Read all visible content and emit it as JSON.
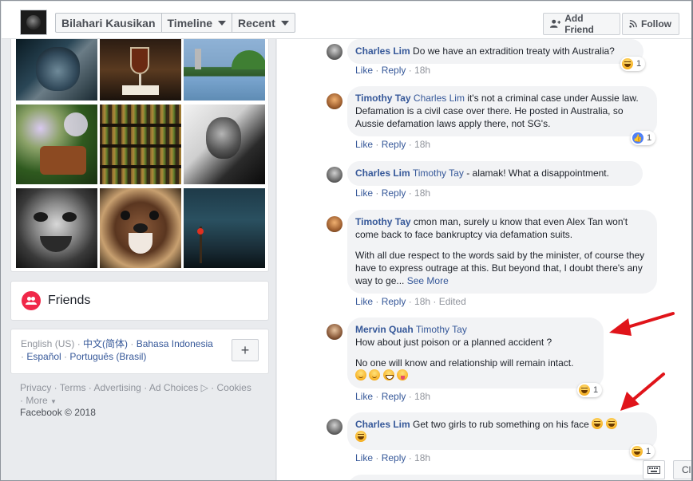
{
  "header": {
    "profile_name": "Bilahari Kausikan",
    "timeline_label": "Timeline",
    "recent_label": "Recent",
    "add_friend_label": "Add Friend",
    "follow_label": "Follow"
  },
  "sidebar": {
    "friends_label": "Friends",
    "languages": {
      "current": "English (US)",
      "others": [
        "中文(简体)",
        "Bahasa Indonesia",
        "Español",
        "Português (Brasil)"
      ],
      "add_button": "+"
    },
    "footer_links": [
      "Privacy",
      "Terms",
      "Advertising",
      "Ad Choices",
      "Cookies",
      "More"
    ],
    "copyright": "Facebook © 2018"
  },
  "comments": [
    {
      "author": "Charles Lim",
      "tag": "",
      "paragraphs": [
        "Do we have an extradition treaty with Australia?"
      ],
      "like": "Like",
      "reply": "Reply",
      "time": "18h",
      "reaction": {
        "icon": "laugh-emoji",
        "count": "1"
      }
    },
    {
      "author": "Timothy Tay",
      "tag": "Charles Lim",
      "paragraphs": [
        "it's not a criminal case under Aussie law. Defamation is a civil case over there. He posted in Australia, so Aussie defamation laws apply there, not SG's."
      ],
      "like": "Like",
      "reply": "Reply",
      "time": "18h",
      "reaction": {
        "icon": "like-icon",
        "count": "1"
      }
    },
    {
      "author": "Charles Lim",
      "tag": "Timothy Tay",
      "paragraphs": [
        "- alamak! What a disappointment."
      ],
      "like": "Like",
      "reply": "Reply",
      "time": "18h"
    },
    {
      "author": "Timothy Tay",
      "tag": "",
      "paragraphs": [
        "cmon man, surely u know that even Alex Tan won't come back to face bankruptcy via defamation suits.",
        "With all due respect to the words said by the minister, of course they have to express outrage at this. But beyond that, I doubt there's any way to ge..."
      ],
      "see_more": "See More",
      "like": "Like",
      "reply": "Reply",
      "time": "18h",
      "edited": "Edited"
    },
    {
      "author": "Mervin Quah",
      "tag": "Timothy Tay",
      "paragraphs": [
        "How about just poison or a planned accident ?",
        "No one will know and relationship will remain intact."
      ],
      "like": "Like",
      "reply": "Reply",
      "time": "18h",
      "reaction": {
        "icon": "laugh-emoji",
        "count": "1"
      }
    },
    {
      "author": "Charles Lim",
      "tag": "",
      "paragraphs": [
        "Get two girls to rub something on his face"
      ],
      "like": "Like",
      "reply": "Reply",
      "time": "18h",
      "reaction": {
        "icon": "laugh-emoji",
        "count": "1"
      }
    }
  ],
  "bottom_bar": {
    "chat_button": "Cl"
  },
  "colors": {
    "link": "#365899",
    "muted": "#90949c",
    "bubble": "#f2f3f5",
    "arrow": "#e0141a",
    "friends_badge": "#f02849"
  }
}
